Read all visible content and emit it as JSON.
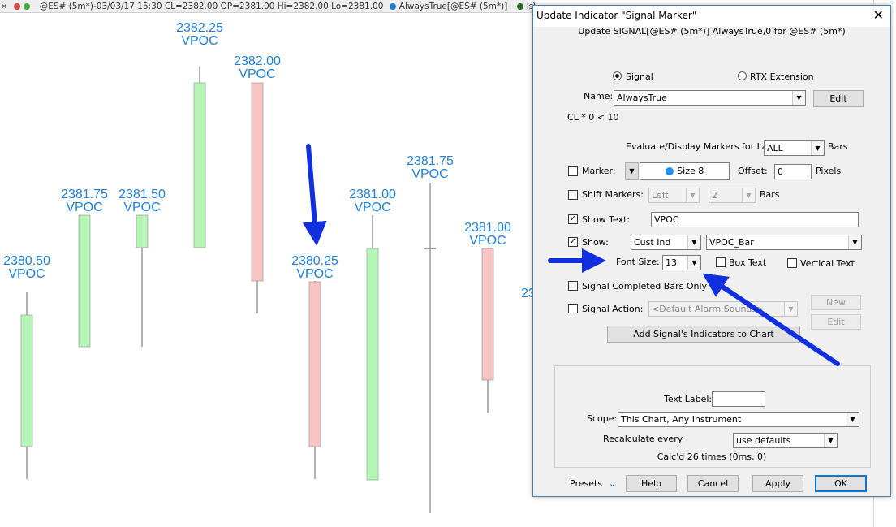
{
  "status_bar": {
    "symbol_info": "@ES# (5m*)-03/03/17 15:30 CL=2382.00 OP=2381.00 Hi=2382.00 Lo=2381.00",
    "indicator1": "AlwaysTrue[@ES# (5m*)]",
    "indicator2": "lsVolumeCandle"
  },
  "colors": {
    "bull_body": "#b5f5b5",
    "bear_body": "#f8c4c4",
    "marker_text": "#1e7fd6",
    "arrow": "#1030e0",
    "marker_dot": "#1e90ff"
  },
  "chart_data": {
    "type": "candlestick",
    "marker_label": "VPOC",
    "candles": [
      {
        "direction": "up",
        "label_price": "2380.50"
      },
      {
        "direction": "up",
        "label_price": "2381.75"
      },
      {
        "direction": "up",
        "label_price": "2381.50"
      },
      {
        "direction": "up",
        "label_price": "2382.25"
      },
      {
        "direction": "down",
        "label_price": "2382.00"
      },
      {
        "direction": "down",
        "label_price": "2380.25"
      },
      {
        "direction": "up",
        "label_price": "2381.00"
      },
      {
        "direction": "doji",
        "label_price": "2381.75"
      },
      {
        "direction": "down",
        "label_price": "2381.00"
      }
    ],
    "partial_label": "23"
  },
  "dialog": {
    "title": "Update Indicator \"Signal Marker\"",
    "subtitle": "Update SIGNAL[@ES# (5m*)] AlwaysTrue,0 for @ES# (5m*)",
    "radio_signal": "Signal",
    "radio_rtx": "RTX Extension",
    "name_label": "Name:",
    "name_value": "AlwaysTrue",
    "edit_button": "Edit",
    "formula": "CL * 0 < 10",
    "evaluate_label": "Evaluate/Display Markers for Last",
    "evaluate_value": "ALL",
    "bars_label": "Bars",
    "marker_label": "Marker:",
    "marker_size": "Size 8",
    "offset_label": "Offset:",
    "offset_value": "0",
    "pixels_label": "Pixels",
    "shift_label": "Shift Markers:",
    "shift_dir": "Left",
    "shift_count": "2",
    "shift_bars_label": "Bars",
    "show_text_label": "Show Text:",
    "show_text_value": "VPOC",
    "show_label": "Show:",
    "show_type": "Cust Ind",
    "show_indicator": "VPOC_Bar",
    "font_size_label": "Font Size:",
    "font_size_value": "13",
    "box_text_label": "Box Text",
    "vertical_text_label": "Vertical Text",
    "completed_label": "Signal Completed Bars Only",
    "action_label": "Signal Action:",
    "action_value": "<Default Alarm Sounds>",
    "new_button": "New",
    "edit2_button": "Edit",
    "add_button": "Add Signal's Indicators to Chart",
    "text_label_label": "Text Label:",
    "text_label_value": "",
    "scope_label": "Scope:",
    "scope_value": "This Chart, Any Instrument",
    "recalc_label": "Recalculate every",
    "recalc_value": "use defaults",
    "calcd_text": "Calc'd 26 times (0ms, 0)",
    "presets_label": "Presets",
    "help_button": "Help",
    "cancel_button": "Cancel",
    "apply_button": "Apply",
    "ok_button": "OK",
    "checks": {
      "marker": false,
      "shift": false,
      "show_text": true,
      "show": true,
      "box_text": false,
      "vertical_text": false,
      "completed": false,
      "action": false
    }
  }
}
